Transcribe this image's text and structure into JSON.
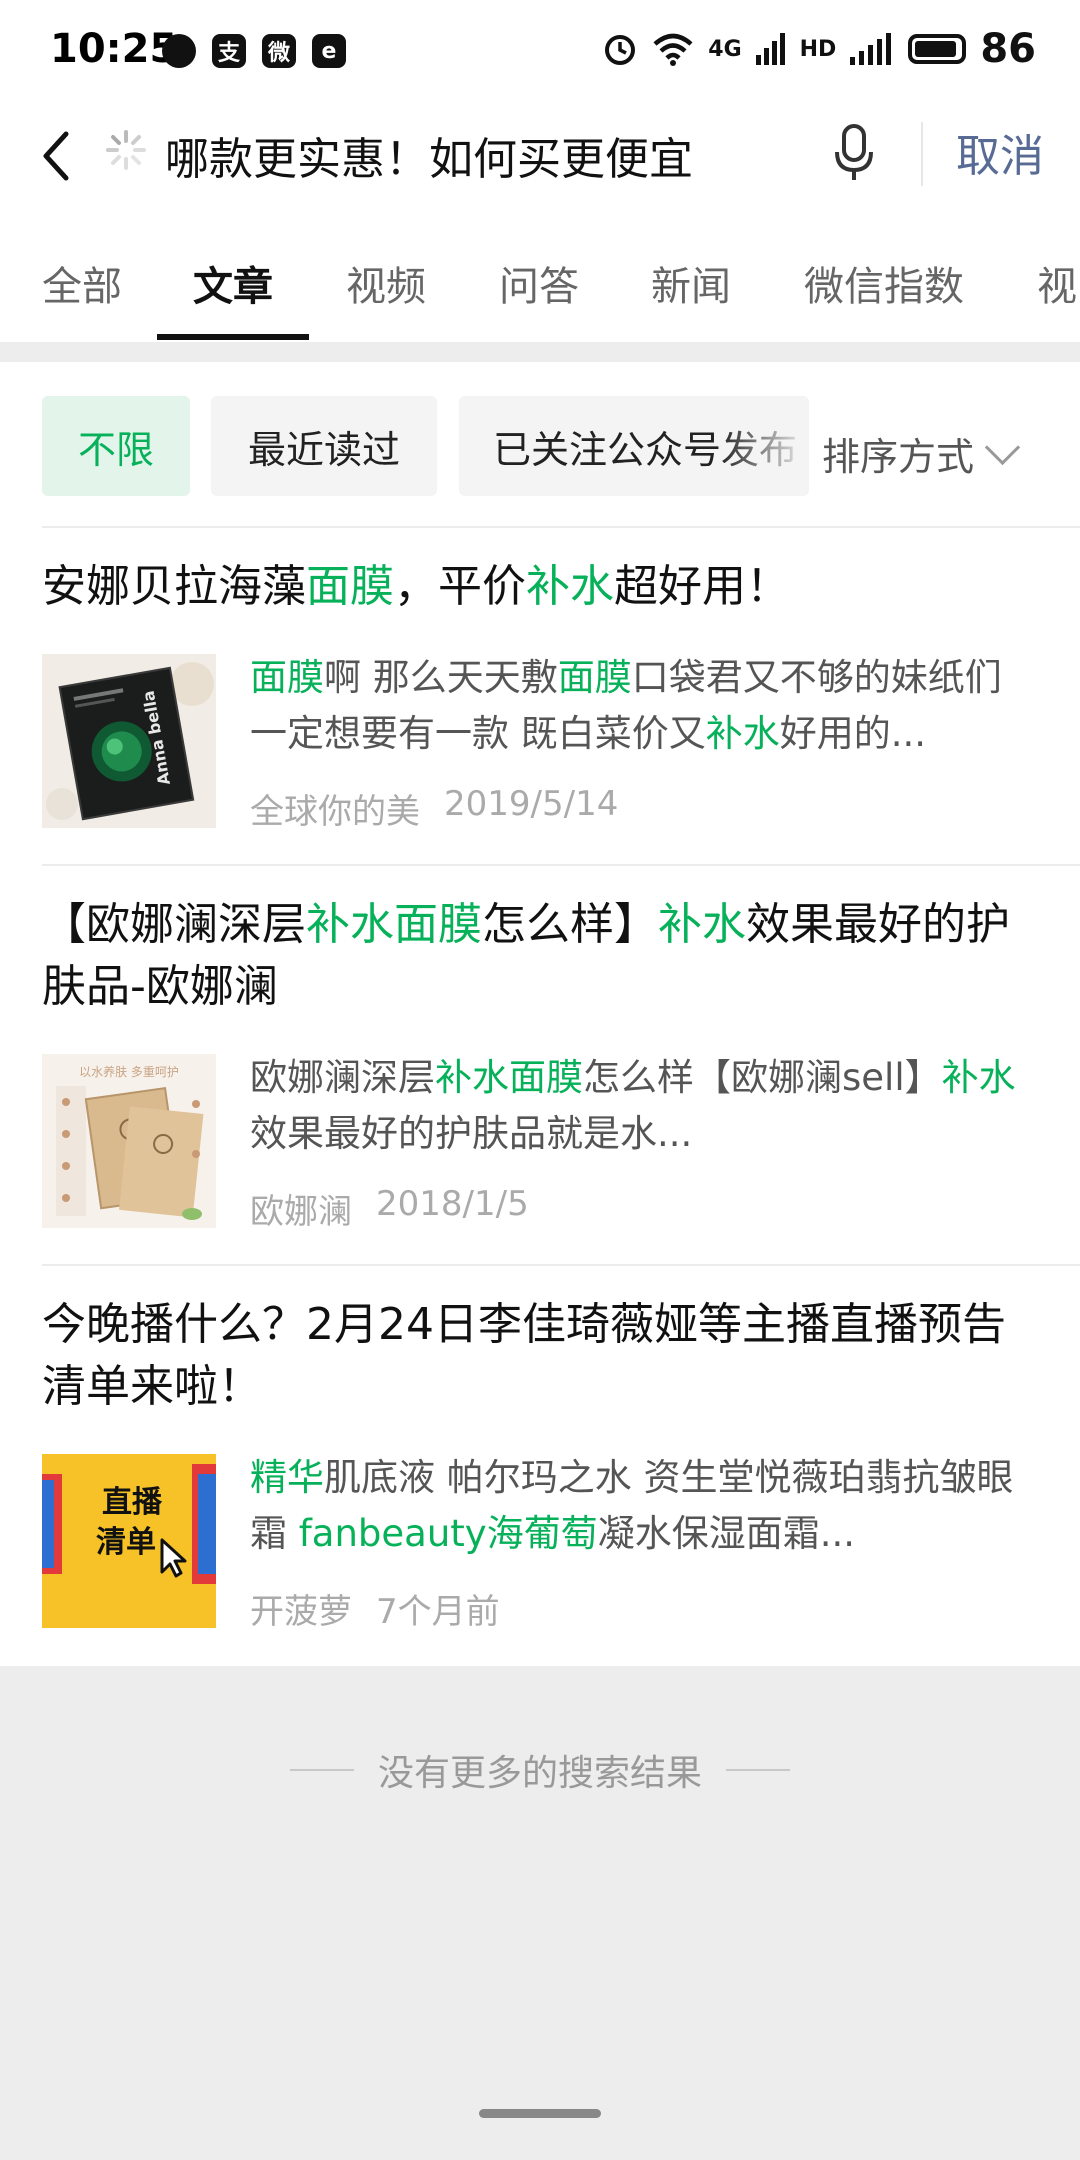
{
  "status_bar": {
    "time": "10:25",
    "network_label": "4G",
    "hd_label": "HD",
    "battery": "86"
  },
  "search": {
    "query": "哪款更实惠！如何买更便宜",
    "cancel_label": "取消"
  },
  "tabs": [
    "全部",
    "文章",
    "视频",
    "问答",
    "新闻",
    "微信指数",
    "视"
  ],
  "active_tab": 1,
  "filters": {
    "chips": [
      "不限",
      "最近读过",
      "已关注公众号发布"
    ],
    "sort_label": "排序方式"
  },
  "results": [
    {
      "title": [
        {
          "t": "安娜贝拉海藻"
        },
        {
          "t": "面膜",
          "hl": true
        },
        {
          "t": "，平价"
        },
        {
          "t": "补水",
          "hl": true
        },
        {
          "t": "超好用！"
        }
      ],
      "snippet": [
        {
          "t": "面膜",
          "hl": true
        },
        {
          "t": "啊 那么天天敷"
        },
        {
          "t": "面膜",
          "hl": true
        },
        {
          "t": "口袋君又不够的妹纸们 一定想要有一款 既白菜价又"
        },
        {
          "t": "补水",
          "hl": true
        },
        {
          "t": "好用的..."
        }
      ],
      "source": "全球你的美",
      "date": "2019/5/14",
      "thumb_text": "Anna bella"
    },
    {
      "title": [
        {
          "t": "【欧娜澜深层"
        },
        {
          "t": "补水面膜",
          "hl": true
        },
        {
          "t": "怎么样】"
        },
        {
          "t": "补水",
          "hl": true
        },
        {
          "t": "效果最好的护肤品-欧娜澜"
        }
      ],
      "snippet": [
        {
          "t": "欧娜澜深层"
        },
        {
          "t": "补水面膜",
          "hl": true
        },
        {
          "t": "怎么样【欧娜澜sell】"
        },
        {
          "t": "补水",
          "hl": true
        },
        {
          "t": "效果最好的护肤品就是水..."
        }
      ],
      "source": "欧娜澜",
      "date": "2018/1/5",
      "thumb_text": "以水养肤 多重呵护"
    },
    {
      "title": [
        {
          "t": "今晚播什么？2月24日李佳琦薇娅等主播直播预告清单来啦！"
        }
      ],
      "snippet": [
        {
          "t": "精华",
          "hl": true
        },
        {
          "t": "肌底液 帕尔玛之水 资生堂悦薇珀翡抗皱眼霜 "
        },
        {
          "t": "fanbeauty海葡萄",
          "hl": true
        },
        {
          "t": "凝水保湿面霜..."
        }
      ],
      "source": "开菠萝",
      "date": "7个月前",
      "thumb_text": "直播清单"
    }
  ],
  "no_more": "没有更多的搜索结果"
}
